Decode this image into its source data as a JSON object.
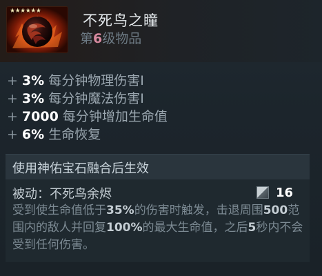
{
  "item": {
    "name": "不死鸟之瞳",
    "tier_prefix": "第",
    "tier_number": "6",
    "tier_suffix": "级物品",
    "stars": "★★★★★★",
    "icon": "phoenix-orb-icon"
  },
  "stats": [
    {
      "plus": "+",
      "value": "3%",
      "label": "每分钟物理伤害I"
    },
    {
      "plus": "+",
      "value": "3%",
      "label": "每分钟魔法伤害I"
    },
    {
      "plus": "+",
      "value": "7000",
      "label": "每分钟增加生命值"
    },
    {
      "plus": "+",
      "value": "6%",
      "label": "生命恢复"
    }
  ],
  "gem_note": "使用神佑宝石融合后生效",
  "ability": {
    "title": "被动：不死鸟余烬",
    "cooldown": "16",
    "cooldown_icon": "cooldown-icon",
    "desc": [
      {
        "t": "受到使生命值低于",
        "b": false
      },
      {
        "t": "35%",
        "b": true
      },
      {
        "t": "的伤害时触发，击退周围",
        "b": false
      },
      {
        "t": "500",
        "b": true
      },
      {
        "t": "范围内的敌人并回复",
        "b": false
      },
      {
        "t": "100%",
        "b": true
      },
      {
        "t": "的最大生命值，之后",
        "b": false
      },
      {
        "t": "5",
        "b": true
      },
      {
        "t": "秒内不会受到任何伤害。",
        "b": false
      }
    ]
  },
  "colors": {
    "background": "#1c252c",
    "value_white": "#ffffff",
    "label_grey": "#9aa6af",
    "tier_pink": "#d88aa0",
    "desc_grey": "#7c8a93"
  }
}
